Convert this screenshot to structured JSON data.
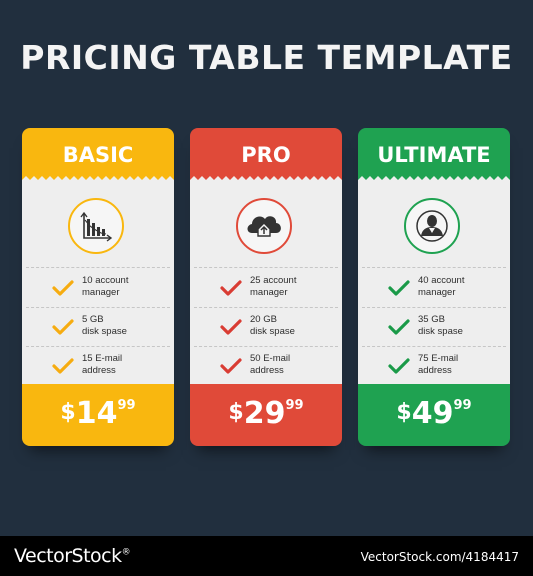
{
  "title": "PRICING TABLE TEMPLATE",
  "plans": [
    {
      "name": "BASIC",
      "color": "#f9b70f",
      "check_color": "#f6ac10",
      "icon": "bar-chart-icon",
      "features": [
        {
          "line1": "10 account",
          "line2": "manager"
        },
        {
          "line1": "5 GB",
          "line2": "disk spase"
        },
        {
          "line1": "15 E-mail",
          "line2": "address"
        }
      ],
      "price": {
        "currency": "$",
        "amount": "14",
        "cents": "99"
      }
    },
    {
      "name": "PRO",
      "color": "#e04a39",
      "check_color": "#d93c33",
      "icon": "cloud-upload-icon",
      "features": [
        {
          "line1": "25 account",
          "line2": "manager"
        },
        {
          "line1": "20 GB",
          "line2": "disk spase"
        },
        {
          "line1": "50 E-mail",
          "line2": "address"
        }
      ],
      "price": {
        "currency": "$",
        "amount": "29",
        "cents": "99"
      }
    },
    {
      "name": "ULTIMATE",
      "color": "#1fa251",
      "check_color": "#1a9a48",
      "icon": "user-icon",
      "features": [
        {
          "line1": "40 account",
          "line2": "manager"
        },
        {
          "line1": "35 GB",
          "line2": "disk spase"
        },
        {
          "line1": "75 E-mail",
          "line2": "address"
        }
      ],
      "price": {
        "currency": "$",
        "amount": "49",
        "cents": "99"
      }
    }
  ],
  "footer": {
    "brand": "VectorStock",
    "trademark": "®",
    "image_id": "VectorStock.com/4184417"
  }
}
